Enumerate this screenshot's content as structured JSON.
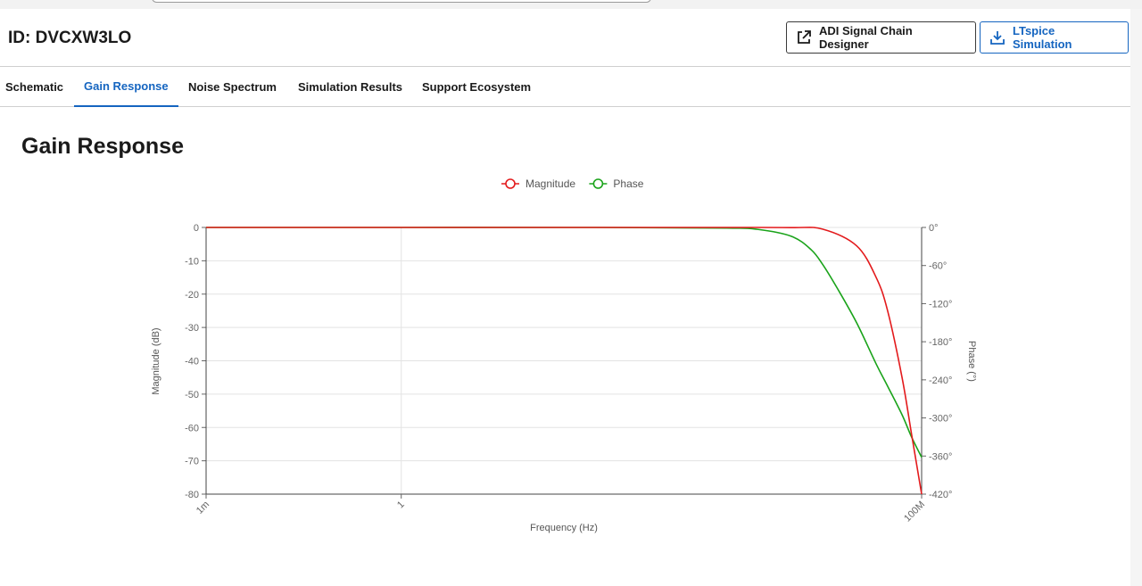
{
  "header": {
    "id_label": "ID: DVCXW3LO",
    "buttons": {
      "adi": "ADI Signal Chain Designer",
      "ltspice": "LTspice Simulation"
    }
  },
  "tabs": [
    {
      "label": "Schematic",
      "active": false
    },
    {
      "label": "Gain Response",
      "active": true
    },
    {
      "label": "Noise Spectrum",
      "active": false
    },
    {
      "label": "Simulation Results",
      "active": false
    },
    {
      "label": "Support Ecosystem",
      "active": false
    }
  ],
  "section": {
    "title": "Gain Response"
  },
  "colors": {
    "accent": "#1565c0",
    "magnitude": "#e31a1c",
    "phase": "#1aa31a"
  },
  "chart_data": {
    "type": "line",
    "xlabel": "Frequency (Hz)",
    "ylabel_left": "Magnitude (dB)",
    "ylabel_right": "Phase (°)",
    "x_scale": "log",
    "xlim": [
      0.001,
      100000000
    ],
    "x_ticks": [
      "1m",
      "1",
      "100M"
    ],
    "ylim_left": [
      -80,
      0
    ],
    "y_ticks_left": [
      "0",
      "-10",
      "-20",
      "-30",
      "-40",
      "-50",
      "-60",
      "-70",
      "-80"
    ],
    "ylim_right": [
      -420,
      0
    ],
    "y_ticks_right": [
      "0°",
      "-60°",
      "-120°",
      "-180°",
      "-240°",
      "-300°",
      "-360°",
      "-420°"
    ],
    "grid": true,
    "legend_position": "top-center",
    "series": [
      {
        "name": "Magnitude",
        "axis": "left",
        "x": [
          0.001,
          1,
          1000,
          100000,
          1000000,
          3000000,
          10000000,
          20000000,
          30000000,
          50000000,
          70000000,
          100000000
        ],
        "y": [
          0,
          0,
          0,
          0,
          -0.05,
          -0.5,
          -5.5,
          -15,
          -25,
          -45,
          -62,
          -80
        ]
      },
      {
        "name": "Phase",
        "axis": "right",
        "x": [
          0.001,
          1,
          1000,
          100000,
          300000,
          1000000,
          2000000,
          3000000,
          5000000,
          10000000,
          20000000,
          30000000,
          50000000,
          70000000,
          100000000
        ],
        "y": [
          0,
          0,
          0,
          -1,
          -3,
          -14,
          -35,
          -58,
          -95,
          -150,
          -215,
          -250,
          -295,
          -330,
          -362
        ]
      }
    ]
  }
}
